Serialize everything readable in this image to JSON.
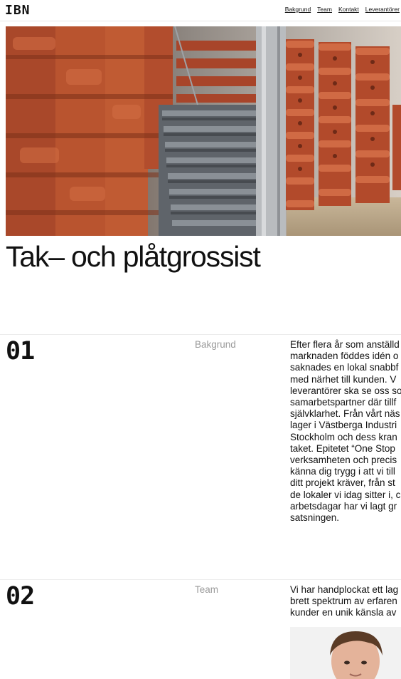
{
  "header": {
    "logo": "IBN",
    "nav": [
      "Bakgrund",
      "Team",
      "Kontakt",
      "Leverantörer"
    ]
  },
  "hero": {
    "title": "Tak– och plåtgrossist"
  },
  "sections": [
    {
      "number": "01",
      "label": "Bakgrund",
      "lines": [
        "Efter flera år som anställd",
        "marknaden föddes idén o",
        "saknades en lokal snabbf",
        "med närhet till kunden. V",
        "leverantörer ska se oss so",
        "samarbetspartner där tillf",
        "självklarhet. Från vårt näs",
        "lager i Västberga Industri",
        "Stockholm och dess kran",
        "taket. Epitetet “One Stop",
        "verksamheten och precis",
        "känna dig trygg i att vi till",
        "ditt projekt kräver, från st",
        "de lokaler vi idag sitter i, c",
        "arbetsdagar har vi lagt gr",
        "satsningen."
      ]
    },
    {
      "number": "02",
      "label": "Team",
      "lines": [
        "Vi har handplockat ett lag",
        "brett spektrum av erfaren",
        "kunder en unik känsla av"
      ]
    }
  ],
  "colors": {
    "accent_orange": "#b9512f",
    "grey_profiles": "#6f747a",
    "muted_label": "#9a9a9a"
  }
}
